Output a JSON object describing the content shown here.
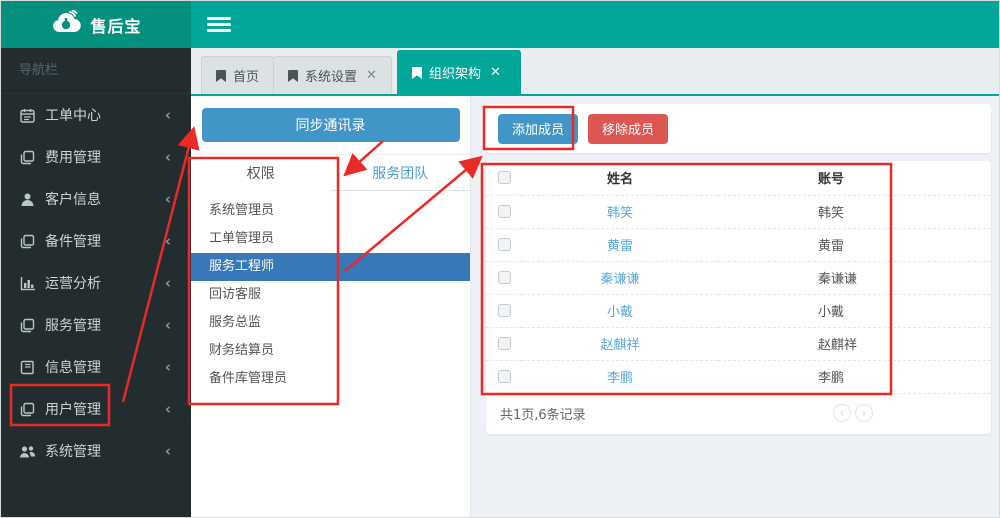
{
  "app": {
    "logo_text": "售后宝",
    "nav_label": "导航栏"
  },
  "colors": {
    "header_teal": "#02a79a",
    "logo_teal": "#03917e",
    "sidebar_bg": "#232d30",
    "primary_blue": "#4295c7",
    "danger_red": "#dd5752",
    "selected_blue": "#3579b8",
    "link_blue": "#5aa7da",
    "annotation_red": "#ea2a25"
  },
  "sidebar": {
    "items": [
      {
        "id": "work-order-center",
        "icon": "calendar",
        "label": "工单中心"
      },
      {
        "id": "expense-management",
        "icon": "copy",
        "label": "费用管理"
      },
      {
        "id": "customer-info",
        "icon": "user",
        "label": "客户信息"
      },
      {
        "id": "spare-parts",
        "icon": "copy",
        "label": "备件管理"
      },
      {
        "id": "operation-analysis",
        "icon": "chart",
        "label": "运营分析"
      },
      {
        "id": "service-management",
        "icon": "copy",
        "label": "服务管理"
      },
      {
        "id": "info-management",
        "icon": "book",
        "label": "信息管理"
      },
      {
        "id": "user-management",
        "icon": "copy",
        "label": "用户管理"
      },
      {
        "id": "system-management",
        "icon": "users",
        "label": "系统管理"
      }
    ]
  },
  "tabs": [
    {
      "id": "home",
      "label": "首页",
      "closable": false,
      "active": false
    },
    {
      "id": "system-settings",
      "label": "系统设置",
      "closable": true,
      "active": false
    },
    {
      "id": "org-structure",
      "label": "组织架构",
      "closable": true,
      "active": true
    }
  ],
  "left_panel": {
    "sync_button": "同步通讯录",
    "tabs": [
      {
        "id": "permissions",
        "label": "权限",
        "active": true
      },
      {
        "id": "service-team",
        "label": "服务团队",
        "active": false
      }
    ],
    "roles": [
      "系统管理员",
      "工单管理员",
      "服务工程师",
      "回访客服",
      "服务总监",
      "财务结算员",
      "备件库管理员"
    ],
    "selected_role": "服务工程师"
  },
  "members": {
    "add_button": "添加成员",
    "remove_button": "移除成员",
    "columns": [
      "姓名",
      "账号"
    ],
    "rows": [
      {
        "name": "韩笑",
        "account": "韩笑"
      },
      {
        "name": "黄雷",
        "account": "黄雷"
      },
      {
        "name": "秦谦谦",
        "account": "秦谦谦"
      },
      {
        "name": "小戴",
        "account": "小戴"
      },
      {
        "name": "赵麒祥",
        "account": "赵麒祥"
      },
      {
        "name": "李鹏",
        "account": "李鹏"
      }
    ],
    "pagination": "共1页,6条记录"
  }
}
